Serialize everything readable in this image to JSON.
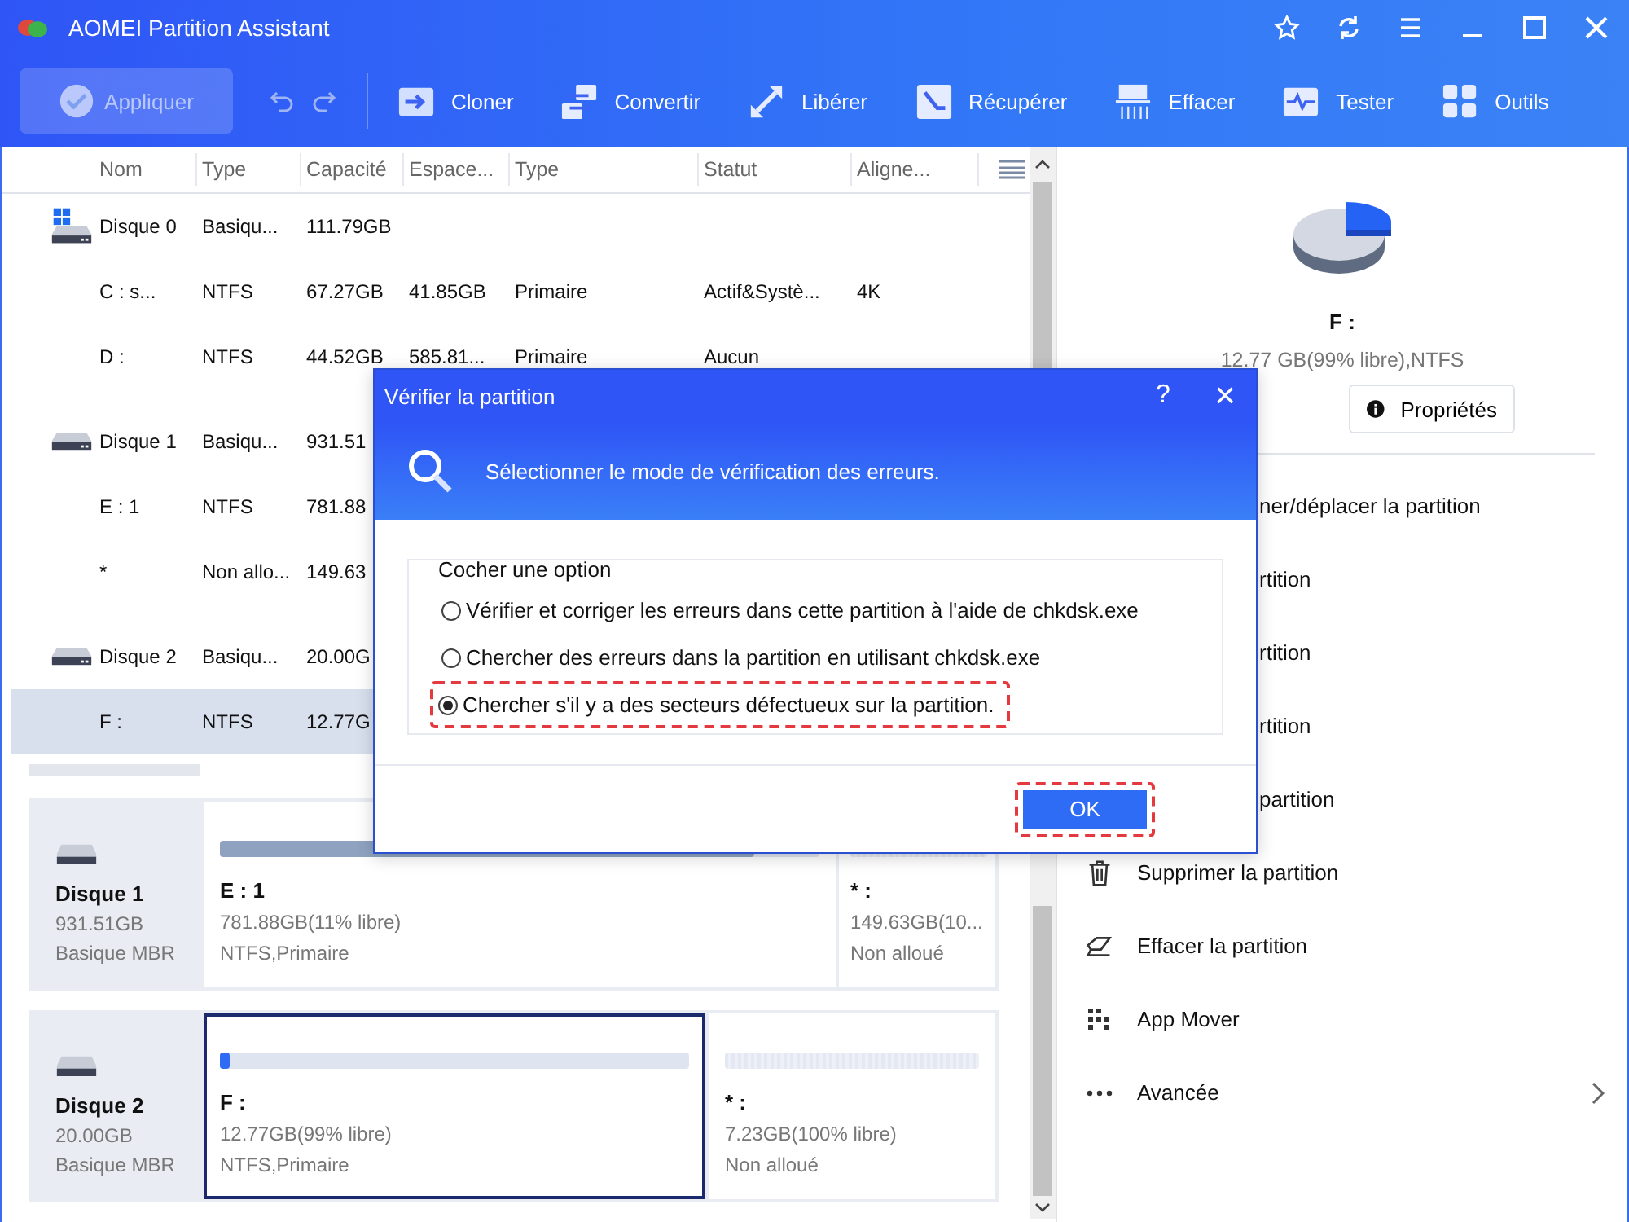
{
  "window": {
    "title": "AOMEI Partition Assistant"
  },
  "toolbar": {
    "apply": {
      "label": "Appliquer",
      "disabled": true
    },
    "tools": [
      {
        "label": "Cloner"
      },
      {
        "label": "Convertir"
      },
      {
        "label": "Libérer"
      },
      {
        "label": "Récupérer"
      },
      {
        "label": "Effacer"
      },
      {
        "label": "Tester"
      },
      {
        "label": "Outils"
      }
    ]
  },
  "table": {
    "columns": [
      "Nom",
      "Type",
      "Capacité",
      "Espace...",
      "Type",
      "Statut",
      "Aligne..."
    ],
    "rows": [
      {
        "kind": "system-disk",
        "selected": false,
        "cells": [
          "Disque 0",
          "Basiqu...",
          "111.79GB"
        ]
      },
      {
        "kind": "partition",
        "selected": false,
        "cells": [
          "C : s...",
          "NTFS",
          "67.27GB",
          "41.85GB",
          "Primaire",
          "Actif&Systè...",
          "4K"
        ]
      },
      {
        "kind": "partition",
        "selected": false,
        "cells": [
          "D :",
          "NTFS",
          "44.52GB",
          "585.81...",
          "Primaire",
          "Aucun"
        ]
      },
      {
        "kind": "disk",
        "selected": false,
        "cells": [
          "Disque 1",
          "Basiqu...",
          "931.51"
        ]
      },
      {
        "kind": "partition",
        "selected": false,
        "cells": [
          "E : 1",
          "NTFS",
          "781.88"
        ]
      },
      {
        "kind": "partition",
        "selected": false,
        "cells": [
          "*",
          "Non allo...",
          "149.63"
        ]
      },
      {
        "kind": "disk",
        "selected": false,
        "cells": [
          "Disque 2",
          "Basiqu...",
          "20.00G"
        ]
      },
      {
        "kind": "partition",
        "selected": true,
        "cells": [
          "F :",
          "NTFS",
          "12.77G"
        ]
      }
    ]
  },
  "disk_map": [
    {
      "name": "Disque 1",
      "size": "931.51GB",
      "type": "Basique MBR",
      "partitions": [
        {
          "kind": "used",
          "label": "E : 1",
          "size": "781.88GB(11% libre)",
          "info": "NTFS,Primaire",
          "level": 0.89,
          "selected": false
        },
        {
          "kind": "unallocated",
          "label": "* :",
          "size": "149.63GB(10...",
          "info": "Non alloué",
          "selected": false
        }
      ]
    },
    {
      "name": "Disque 2",
      "size": "20.00GB",
      "type": "Basique MBR",
      "partitions": [
        {
          "kind": "used",
          "label": "F :",
          "size": "12.77GB(99% libre)",
          "info": "NTFS,Primaire",
          "level": 0.01,
          "selected": true
        },
        {
          "kind": "unallocated",
          "label": "* :",
          "size": "7.23GB(100% libre)",
          "info": "Non alloué",
          "selected": false
        }
      ]
    }
  ],
  "details": {
    "name": "F :",
    "info": "12.77 GB(99% libre),NTFS",
    "button": "Propriétés",
    "operations": [
      {
        "kind": "covered",
        "label": "ner/déplacer la partition"
      },
      {
        "kind": "covered",
        "label": "rtition"
      },
      {
        "kind": "covered",
        "label": "rtition"
      },
      {
        "kind": "covered",
        "label": "rtition"
      },
      {
        "kind": "covered",
        "label": "partition"
      },
      {
        "kind": "delete",
        "label": "Supprimer la partition"
      },
      {
        "kind": "wipe",
        "label": "Effacer la partition"
      },
      {
        "kind": "mover",
        "label": "App Mover"
      },
      {
        "kind": "more",
        "label": "Avancée",
        "submenu": true
      }
    ]
  },
  "dialog": {
    "title": "Vérifier la partition",
    "help": "?",
    "close": "×",
    "heading": "Sélectionner le mode de vérification des erreurs.",
    "group": "Cocher une option",
    "options": [
      {
        "label": "Vérifier et corriger les erreurs dans cette partition à l'aide de chkdsk.exe",
        "selected": false,
        "highlight": false
      },
      {
        "label": "Chercher des erreurs dans la partition en utilisant chkdsk.exe",
        "selected": false,
        "highlight": false
      },
      {
        "label": "Chercher s'il y a des secteurs défectueux sur la partition.",
        "selected": true,
        "highlight": true
      }
    ],
    "ok": {
      "label": "OK",
      "highlight": true
    }
  }
}
